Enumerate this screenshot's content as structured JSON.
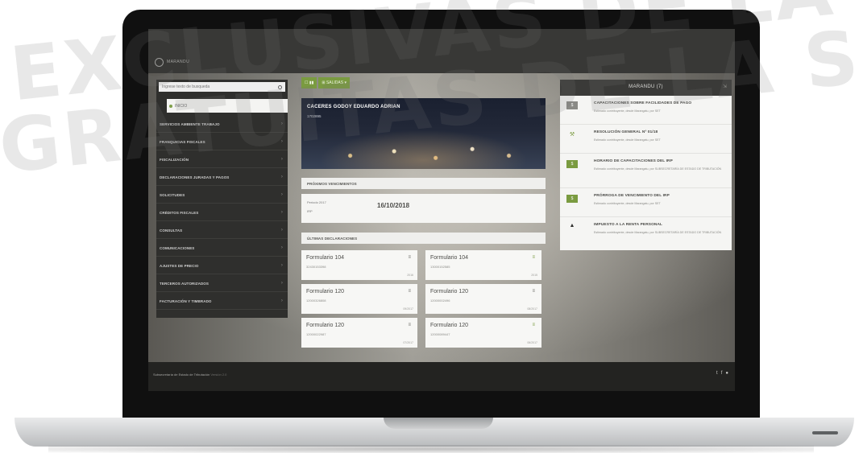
{
  "watermark": {
    "line1": "EXCLUSIVAS DE LA",
    "line2": "GRATUITAS DE LA S"
  },
  "topbar": {
    "logo_text": "MARANDU"
  },
  "sidebar": {
    "search_placeholder": "Ingrese texto de busqueda",
    "home_label": "INICIO",
    "items": [
      {
        "label": "SERVICIOS AMBIENTE TRABAJO"
      },
      {
        "label": "FRANQUICIAS FISCALES"
      },
      {
        "label": "FISCALIZACIÓN"
      },
      {
        "label": "DECLARACIONES JURADAS Y PAGOS"
      },
      {
        "label": "SOLICITUDES"
      },
      {
        "label": "CRÉDITOS FISCALES"
      },
      {
        "label": "CONSULTAS"
      },
      {
        "label": "COMUNICACIONES"
      },
      {
        "label": "AJUSTES DE PRECIO"
      },
      {
        "label": "TERCEROS AUTORIZADOS"
      },
      {
        "label": "FACTURACIÓN Y TIMBRADO"
      }
    ]
  },
  "tabs": {
    "first": "☐ ▮▮",
    "second": "⊞ SALIDAS ▾"
  },
  "profile": {
    "name": "CACERES GODOY EDUARDO ADRIAN",
    "ruc": "1702895"
  },
  "vencimientos": {
    "title": "PRÓXIMOS VENCIMIENTOS",
    "period_label": "Periodo 2017",
    "tax": "IRP",
    "date": "16/10/2018"
  },
  "declaraciones": {
    "title": "ÚLTIMAS DECLARACIONES",
    "forms": [
      {
        "title": "Formulario 104",
        "number": "32430153398",
        "period": "2016"
      },
      {
        "title": "Formulario 104",
        "number": "13000152585",
        "period": "2015"
      },
      {
        "title": "Formulario 120",
        "number": "12000326808",
        "period": "09/2017"
      },
      {
        "title": "Formulario 120",
        "number": "12000002496",
        "period": "08/2017"
      },
      {
        "title": "Formulario 120",
        "number": "12000022987",
        "period": "07/2017"
      },
      {
        "title": "Formulario 120",
        "number": "12000089447",
        "period": "06/2017"
      }
    ]
  },
  "notifications": {
    "header": "MARANDU (7)",
    "items": [
      {
        "title": "CAPACITACIONES SOBRE FACILIDADES DE PAGO",
        "desc": "Estimado contribuyente, desde Marangatu, por SET"
      },
      {
        "title": "RESOLUCIÓN GENERAL Nº 01/18",
        "desc": "Estimado contribuyente, desde Marangatu, por SET"
      },
      {
        "title": "HORARIO DE CAPACITACIONES DEL IRP",
        "desc": "Estimado contribuyente, desde Marangatu, por SUBSECRETARÍA DE ESTADO DE TRIBUTACIÓN"
      },
      {
        "title": "PRÓRROGA DE VENCIMIENTO DEL IRP",
        "desc": "Estimado contribuyente, desde Marangatu, por SET"
      },
      {
        "title": "IMPUESTO A LA RENTA PERSONAL",
        "desc": "Estimado contribuyente, desde Marangatu, por SUBSECRETARÍA DE ESTADO DE TRIBUTACIÓN"
      }
    ]
  },
  "footer": {
    "main": "Subsecretaría de Estado de Tributación",
    "muted": "Versión 2.0"
  }
}
